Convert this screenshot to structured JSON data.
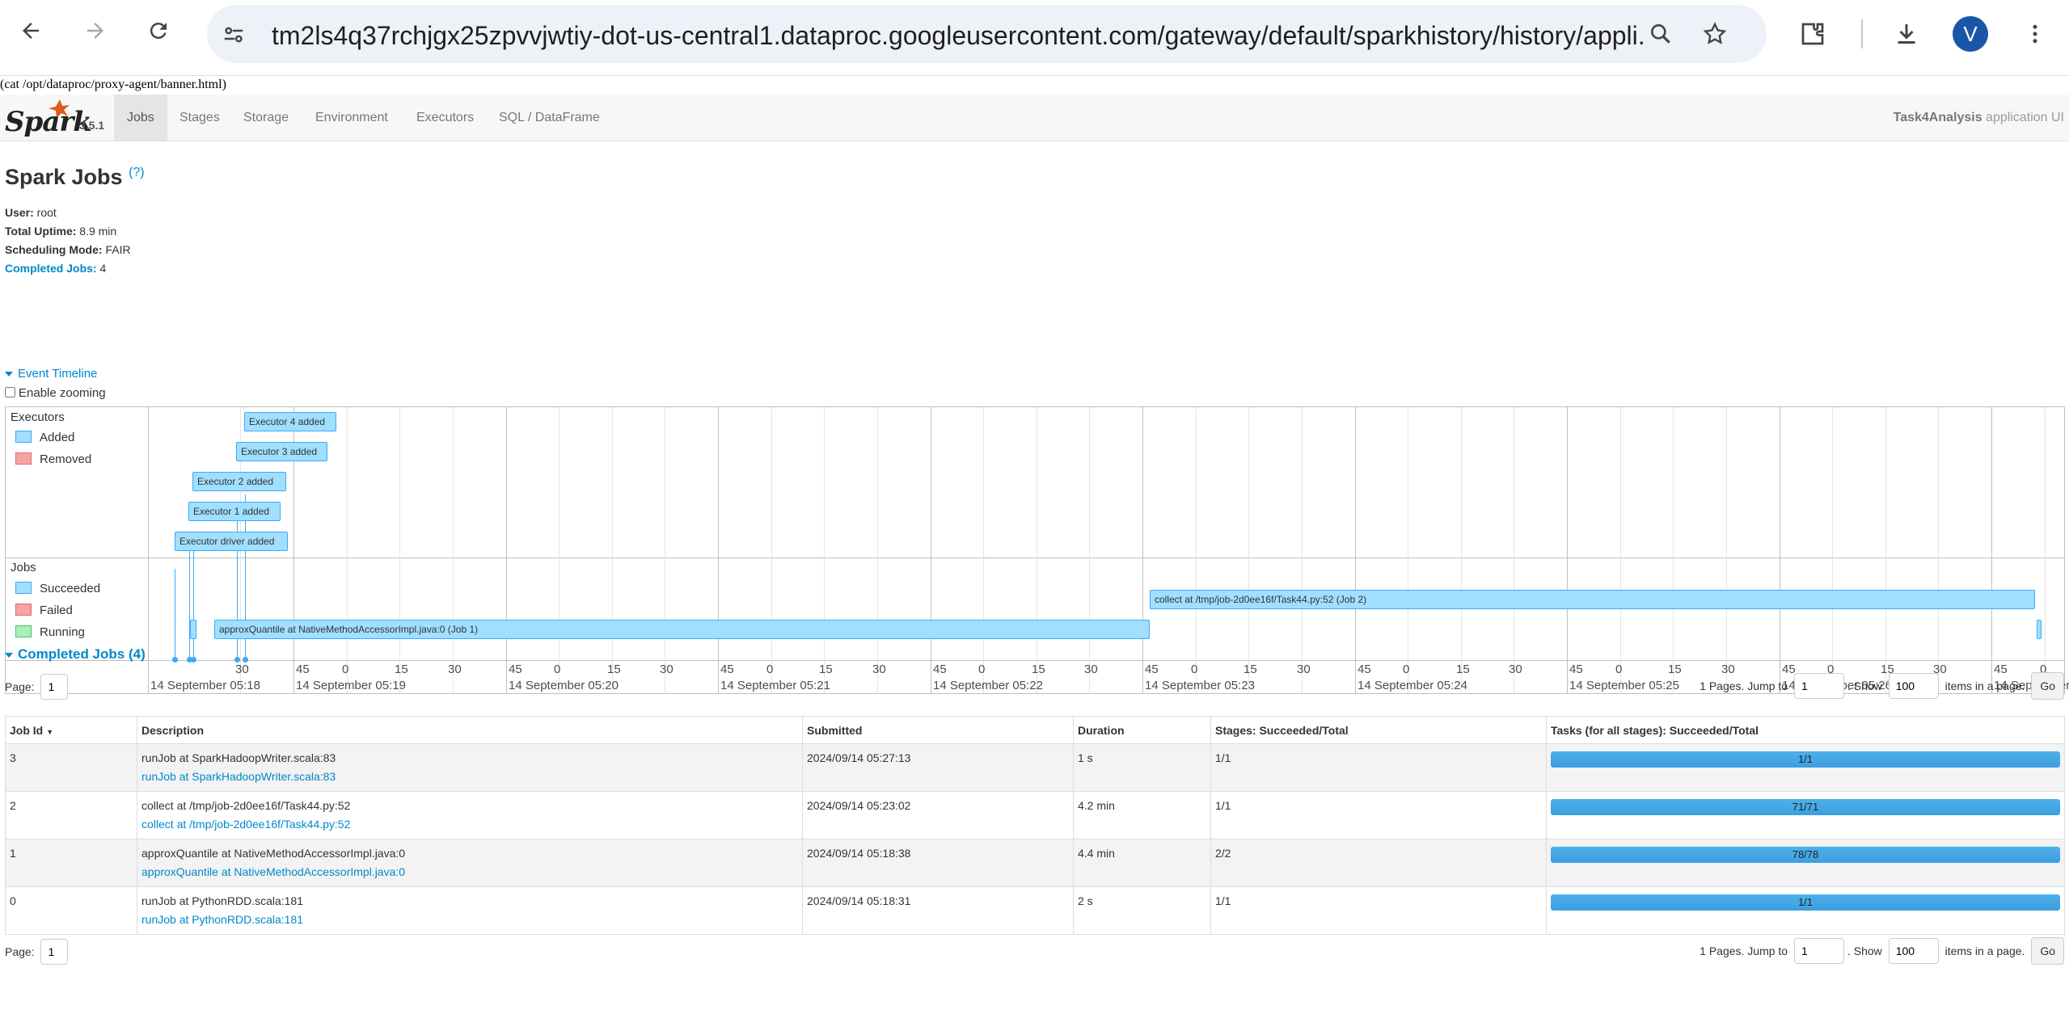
{
  "browser": {
    "url": "tm2ls4q37rchjgx25zpvvjwtiy-dot-us-central1.dataproc.googleusercontent.com/gateway/default/sparkhistory/history/appli...",
    "profile_initial": "V"
  },
  "banner_text": "(cat /opt/dataproc/proxy-agent/banner.html)",
  "navbar": {
    "logo_text": "Spark",
    "version": "3.5.1",
    "tabs": [
      "Jobs",
      "Stages",
      "Storage",
      "Environment",
      "Executors",
      "SQL / DataFrame"
    ],
    "active_tab": "Jobs",
    "app_name": "Task4Analysis",
    "app_suffix": " application UI"
  },
  "header": {
    "title": "Spark Jobs",
    "help": "(?)",
    "user_label": "User:",
    "user_value": " root",
    "uptime_label": "Total Uptime:",
    "uptime_value": " 8.9 min",
    "sched_label": "Scheduling Mode:",
    "sched_value": " FAIR",
    "completed_label": "Completed Jobs:",
    "completed_value": " 4"
  },
  "timeline": {
    "toggle_label": "Event Timeline",
    "zoom_label": "Enable zooming",
    "executors_group": "Executors",
    "exec_legend": [
      "Added",
      "Removed"
    ],
    "jobs_group": "Jobs",
    "job_legend": [
      "Succeeded",
      "Failed",
      "Running"
    ],
    "executor_events": [
      "Executor 4 added",
      "Executor 3 added",
      "Executor 2 added",
      "Executor 1 added",
      "Executor driver added"
    ],
    "job_events": [
      "collect at /tmp/job-2d0ee16f/Task44.py:52 (Job 2)",
      "approxQuantile at NativeMethodAccessorImpl.java:0 (Job 1)"
    ],
    "axis_ticks": [
      "30",
      "45",
      "0",
      "15",
      "30",
      "45",
      "0",
      "15",
      "30",
      "45",
      "0",
      "15",
      "30",
      "45",
      "0",
      "15",
      "30",
      "45",
      "0",
      "15",
      "30",
      "45",
      "0",
      "15",
      "30",
      "45",
      "0",
      "15",
      "30",
      "45",
      "0",
      "15",
      "30",
      "45",
      "0",
      "15"
    ],
    "axis_dates": [
      "14 September 05:18",
      "14 September 05:19",
      "14 September 05:20",
      "14 September 05:21",
      "14 September 05:22",
      "14 September 05:23",
      "14 September 05:24",
      "14 September 05:25",
      "14 September 05:26",
      "14 September"
    ],
    "colors": {
      "succeeded": "#a0dfff",
      "failed": "#f5a3a3",
      "running": "#a8f0b8",
      "border": "#3fa9f5"
    }
  },
  "completed_jobs": {
    "toggle_label": "Completed Jobs (4)",
    "page_label": "Page:",
    "page_value": "1",
    "pages_text": "1 Pages. Jump to",
    "jump_value": "1",
    "show_label": ". Show",
    "show_value": "100",
    "items_label": "items in a page.",
    "go_label": "Go",
    "columns": [
      "Job Id",
      "Description",
      "Submitted",
      "Duration",
      "Stages: Succeeded/Total",
      "Tasks (for all stages): Succeeded/Total"
    ],
    "rows": [
      {
        "id": "3",
        "desc": "runJob at SparkHadoopWriter.scala:83",
        "link": "runJob at SparkHadoopWriter.scala:83",
        "submitted": "2024/09/14 05:27:13",
        "duration": "1 s",
        "stages": "1/1",
        "tasks": "1/1",
        "progress": 1.0
      },
      {
        "id": "2",
        "desc": "collect at /tmp/job-2d0ee16f/Task44.py:52",
        "link": "collect at /tmp/job-2d0ee16f/Task44.py:52",
        "submitted": "2024/09/14 05:23:02",
        "duration": "4.2 min",
        "stages": "1/1",
        "tasks": "71/71",
        "progress": 1.0
      },
      {
        "id": "1",
        "desc": "approxQuantile at NativeMethodAccessorImpl.java:0",
        "link": "approxQuantile at NativeMethodAccessorImpl.java:0",
        "submitted": "2024/09/14 05:18:38",
        "duration": "4.4 min",
        "stages": "2/2",
        "tasks": "78/78",
        "progress": 1.0
      },
      {
        "id": "0",
        "desc": "runJob at PythonRDD.scala:181",
        "link": "runJob at PythonRDD.scala:181",
        "submitted": "2024/09/14 05:18:31",
        "duration": "2 s",
        "stages": "1/1",
        "tasks": "1/1",
        "progress": 1.0
      }
    ]
  }
}
